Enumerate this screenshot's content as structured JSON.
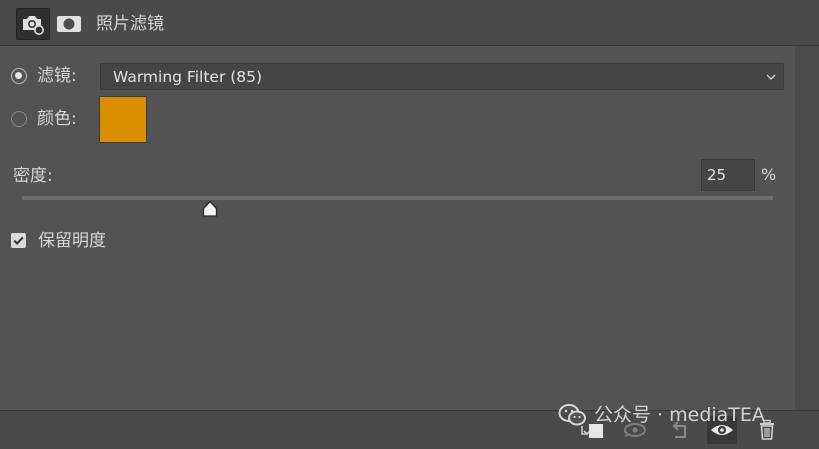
{
  "panel": {
    "title": "照片滤镜",
    "icons": [
      "adjustment-layer-icon",
      "layer-mask-icon"
    ]
  },
  "filter_option": {
    "label": "滤镜:",
    "selected": true,
    "dropdown_value": "Warming Filter (85)"
  },
  "color_option": {
    "label": "颜色:",
    "selected": false,
    "swatch_color": "#d98f00"
  },
  "density": {
    "label": "密度:",
    "value": "25",
    "unit": "%",
    "slider_percent": 25
  },
  "preserve_luminosity": {
    "label": "保留明度",
    "checked": true
  },
  "footer": {
    "buttons": [
      "clip-to-layer-icon",
      "view-previous-state-icon",
      "reset-icon",
      "visibility-eye-icon",
      "trash-icon"
    ]
  },
  "watermark": {
    "text": "公众号 · mediaTEA"
  },
  "colors": {
    "panel_bg": "#535353",
    "accent_swatch": "#d98f00"
  }
}
